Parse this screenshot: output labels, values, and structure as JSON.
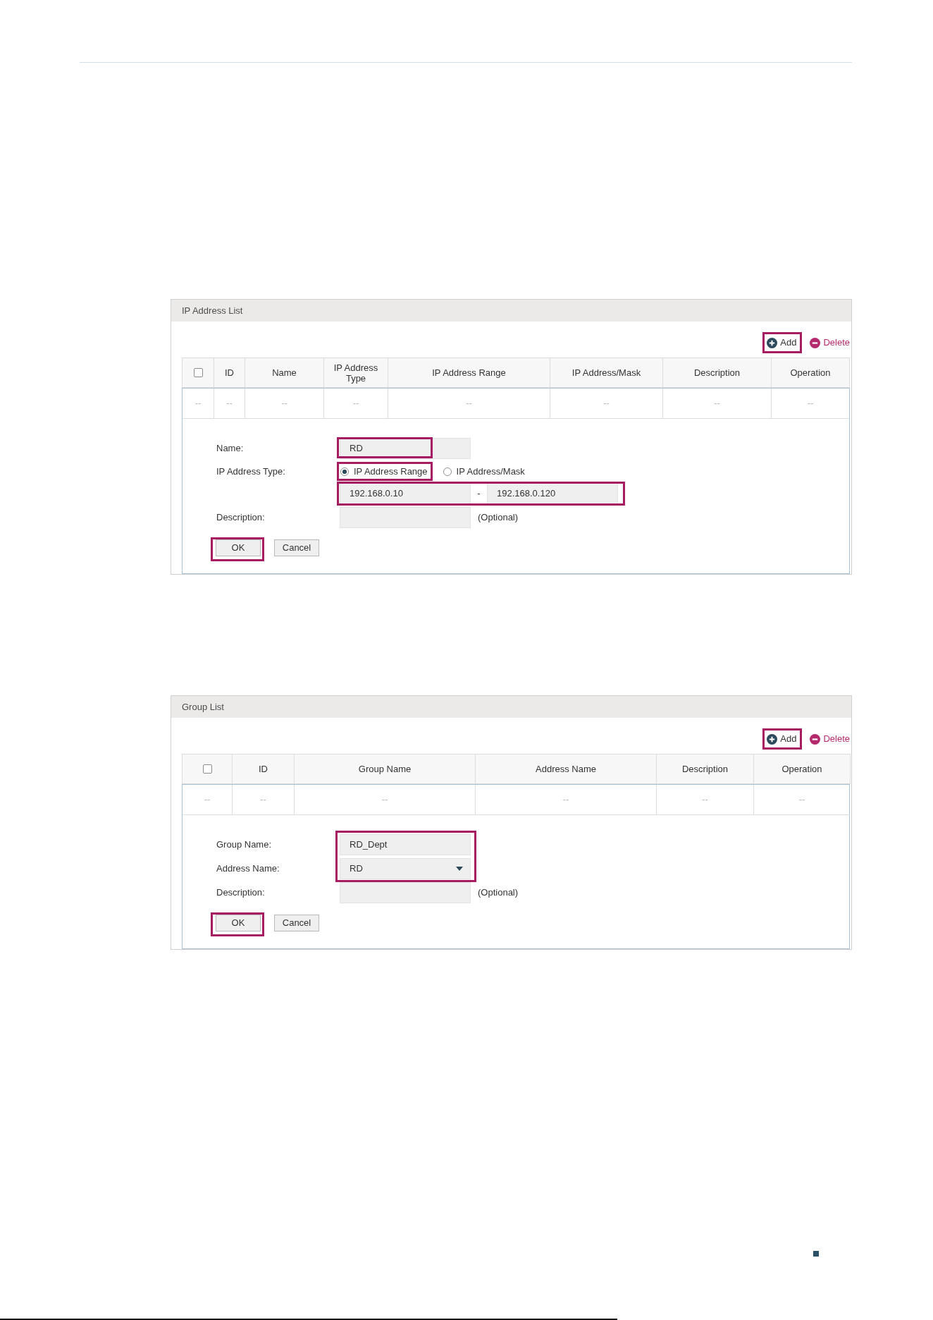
{
  "figures": [
    {
      "title": "IP Address List",
      "toolbar": [
        {
          "kind": "add",
          "label": "Add",
          "highlighted": true
        },
        {
          "kind": "delete",
          "label": "Delete",
          "highlighted": false
        }
      ],
      "table": {
        "header_checkbox": {
          "checked": false
        },
        "columns": [
          "",
          "ID",
          "Name",
          "IP Address Type",
          "IP Address Range",
          "IP Address/Mask",
          "Description",
          "Operation"
        ],
        "rows": [
          [
            "--",
            "--",
            "--",
            "--",
            "--",
            "--",
            "--",
            "--"
          ]
        ]
      },
      "form": {
        "fields": [
          {
            "kind": "text",
            "label": "Name:",
            "value": "RD",
            "highlighted": true
          },
          {
            "kind": "radio",
            "label": "IP Address Type:",
            "options": [
              {
                "label": "IP Address Range",
                "selected": true,
                "highlighted": true
              },
              {
                "label": "IP Address/Mask",
                "selected": false,
                "highlighted": false
              }
            ]
          },
          {
            "kind": "range",
            "from": "192.168.0.10",
            "separator": "-",
            "to": "192.168.0.120",
            "highlighted": true
          },
          {
            "kind": "text",
            "label": "Description:",
            "note": "(Optional)",
            "highlighted": false
          }
        ],
        "buttons": [
          {
            "label": "OK",
            "highlighted": true
          },
          {
            "label": "Cancel",
            "highlighted": false
          }
        ]
      }
    },
    {
      "title": "Group List",
      "toolbar": [
        {
          "kind": "add",
          "label": "Add",
          "highlighted": true
        },
        {
          "kind": "delete",
          "label": "Delete",
          "highlighted": false
        }
      ],
      "table": {
        "header_checkbox": {
          "checked": false
        },
        "columns": [
          "",
          "ID",
          "Group Name",
          "Address Name",
          "Description",
          "Operation"
        ],
        "rows": [
          [
            "--",
            "--",
            "--",
            "--",
            "--",
            "--"
          ]
        ]
      },
      "form": {
        "fields": [
          {
            "kind": "text",
            "label": "Group Name:",
            "value": "RD_Dept",
            "highlighted": true
          },
          {
            "kind": "select",
            "label": "Address Name:",
            "value": "RD",
            "highlighted": true
          },
          {
            "kind": "text",
            "label": "Description:",
            "note": "(Optional)",
            "highlighted": false
          }
        ],
        "buttons": [
          {
            "label": "OK",
            "highlighted": true
          },
          {
            "label": "Cancel",
            "highlighted": false
          }
        ]
      }
    }
  ]
}
